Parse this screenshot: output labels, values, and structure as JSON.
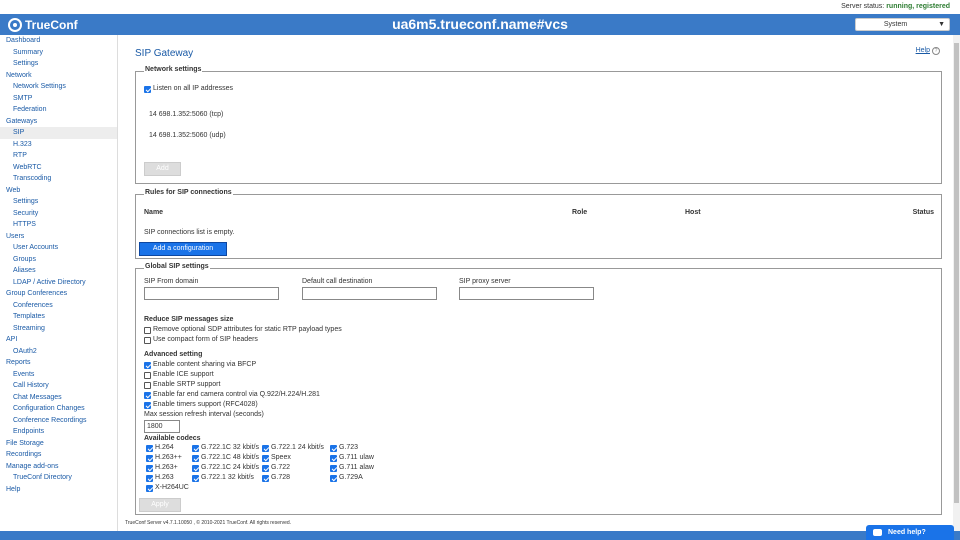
{
  "topbar": {
    "status_label": "Server status:",
    "status_value": "running, registered"
  },
  "header": {
    "logo_text": "TrueConf",
    "host": "ua6m5.trueconf.name#vcs",
    "system_select": "System"
  },
  "sidebar": [
    {
      "type": "group",
      "label": "Dashboard"
    },
    {
      "type": "item",
      "label": "Summary"
    },
    {
      "type": "item",
      "label": "Settings"
    },
    {
      "type": "group",
      "label": "Network"
    },
    {
      "type": "item",
      "label": "Network Settings"
    },
    {
      "type": "item",
      "label": "SMTP"
    },
    {
      "type": "item",
      "label": "Federation"
    },
    {
      "type": "group",
      "label": "Gateways"
    },
    {
      "type": "item",
      "label": "SIP",
      "active": true
    },
    {
      "type": "item",
      "label": "H.323"
    },
    {
      "type": "item",
      "label": "RTP"
    },
    {
      "type": "item",
      "label": "WebRTC"
    },
    {
      "type": "item",
      "label": "Transcoding"
    },
    {
      "type": "group",
      "label": "Web"
    },
    {
      "type": "item",
      "label": "Settings"
    },
    {
      "type": "item",
      "label": "Security"
    },
    {
      "type": "item",
      "label": "HTTPS"
    },
    {
      "type": "group",
      "label": "Users"
    },
    {
      "type": "item",
      "label": "User Accounts"
    },
    {
      "type": "item",
      "label": "Groups"
    },
    {
      "type": "item",
      "label": "Aliases"
    },
    {
      "type": "item",
      "label": "LDAP / Active Directory"
    },
    {
      "type": "group",
      "label": "Group Conferences"
    },
    {
      "type": "item",
      "label": "Conferences"
    },
    {
      "type": "item",
      "label": "Templates"
    },
    {
      "type": "item",
      "label": "Streaming"
    },
    {
      "type": "group",
      "label": "API"
    },
    {
      "type": "item",
      "label": "OAuth2"
    },
    {
      "type": "group",
      "label": "Reports"
    },
    {
      "type": "item",
      "label": "Events"
    },
    {
      "type": "item",
      "label": "Call History"
    },
    {
      "type": "item",
      "label": "Chat Messages"
    },
    {
      "type": "item",
      "label": "Configuration Changes"
    },
    {
      "type": "item",
      "label": "Conference Recordings"
    },
    {
      "type": "item",
      "label": "Endpoints"
    },
    {
      "type": "group",
      "label": "File Storage"
    },
    {
      "type": "group",
      "label": "Recordings"
    },
    {
      "type": "group",
      "label": "Manage add-ons"
    },
    {
      "type": "item",
      "label": "TrueConf Directory"
    },
    {
      "type": "group",
      "label": "Help"
    }
  ],
  "page": {
    "title": "SIP Gateway",
    "help": "Help"
  },
  "network": {
    "title": "Network settings",
    "listen_all": "Listen on all IP addresses",
    "listen_all_checked": true,
    "addresses": [
      "14 698.1.352:5060 (tcp)",
      "14 698.1.352:5060 (udp)"
    ],
    "add_button": "Add"
  },
  "rules": {
    "title": "Rules for SIP connections",
    "col_name": "Name",
    "col_role": "Role",
    "col_host": "Host",
    "col_status": "Status",
    "empty": "SIP connections list is empty.",
    "add_button": "Add a configuration"
  },
  "global": {
    "title": "Global SIP settings",
    "from_domain_label": "SIP From domain",
    "from_domain_value": "",
    "default_dest_label": "Default call destination",
    "default_dest_value": "",
    "proxy_label": "SIP proxy server",
    "proxy_value": "",
    "reduce_title": "Reduce SIP messages size",
    "reduce": [
      {
        "label": "Remove optional SDP attributes for static RTP payload types",
        "checked": false
      },
      {
        "label": "Use compact form of SIP headers",
        "checked": false
      }
    ],
    "advanced_title": "Advanced setting",
    "advanced": [
      {
        "label": "Enable content sharing via BFCP",
        "checked": true
      },
      {
        "label": "Enable ICE support",
        "checked": false
      },
      {
        "label": "Enable SRTP support",
        "checked": false
      },
      {
        "label": "Enable far end camera control via Q.922/H.224/H.281",
        "checked": true
      },
      {
        "label": "Enable timers support (RFC4028)",
        "checked": true
      }
    ],
    "refresh_label": "Max session refresh interval (seconds)",
    "refresh_value": "1800",
    "codecs_title": "Available codecs",
    "codec_cols": [
      [
        {
          "label": "H.264",
          "checked": true
        },
        {
          "label": "H.263++",
          "checked": true
        },
        {
          "label": "H.263+",
          "checked": true
        },
        {
          "label": "H.263",
          "checked": true
        },
        {
          "label": "X-H264UC",
          "checked": true
        }
      ],
      [
        {
          "label": "G.722.1C 32 kbit/s",
          "checked": true
        },
        {
          "label": "G.722.1C 48 kbit/s",
          "checked": true
        },
        {
          "label": "G.722.1C 24 kbit/s",
          "checked": true
        },
        {
          "label": "G.722.1 32 kbit/s",
          "checked": true
        }
      ],
      [
        {
          "label": "G.722.1 24 kbit/s",
          "checked": true
        },
        {
          "label": "Speex",
          "checked": true
        },
        {
          "label": "G.722",
          "checked": true
        },
        {
          "label": "G.728",
          "checked": true
        }
      ],
      [
        {
          "label": "G.723",
          "checked": true
        },
        {
          "label": "G.711 ulaw",
          "checked": true
        },
        {
          "label": "G.711 alaw",
          "checked": true
        },
        {
          "label": "G.729A",
          "checked": true
        }
      ]
    ],
    "apply_button": "Apply"
  },
  "footer": {
    "text": "TrueConf Server v4.7.1.10050 , © 2010-2021 TrueConf. All rights reserved."
  },
  "need_help": "Need help?"
}
